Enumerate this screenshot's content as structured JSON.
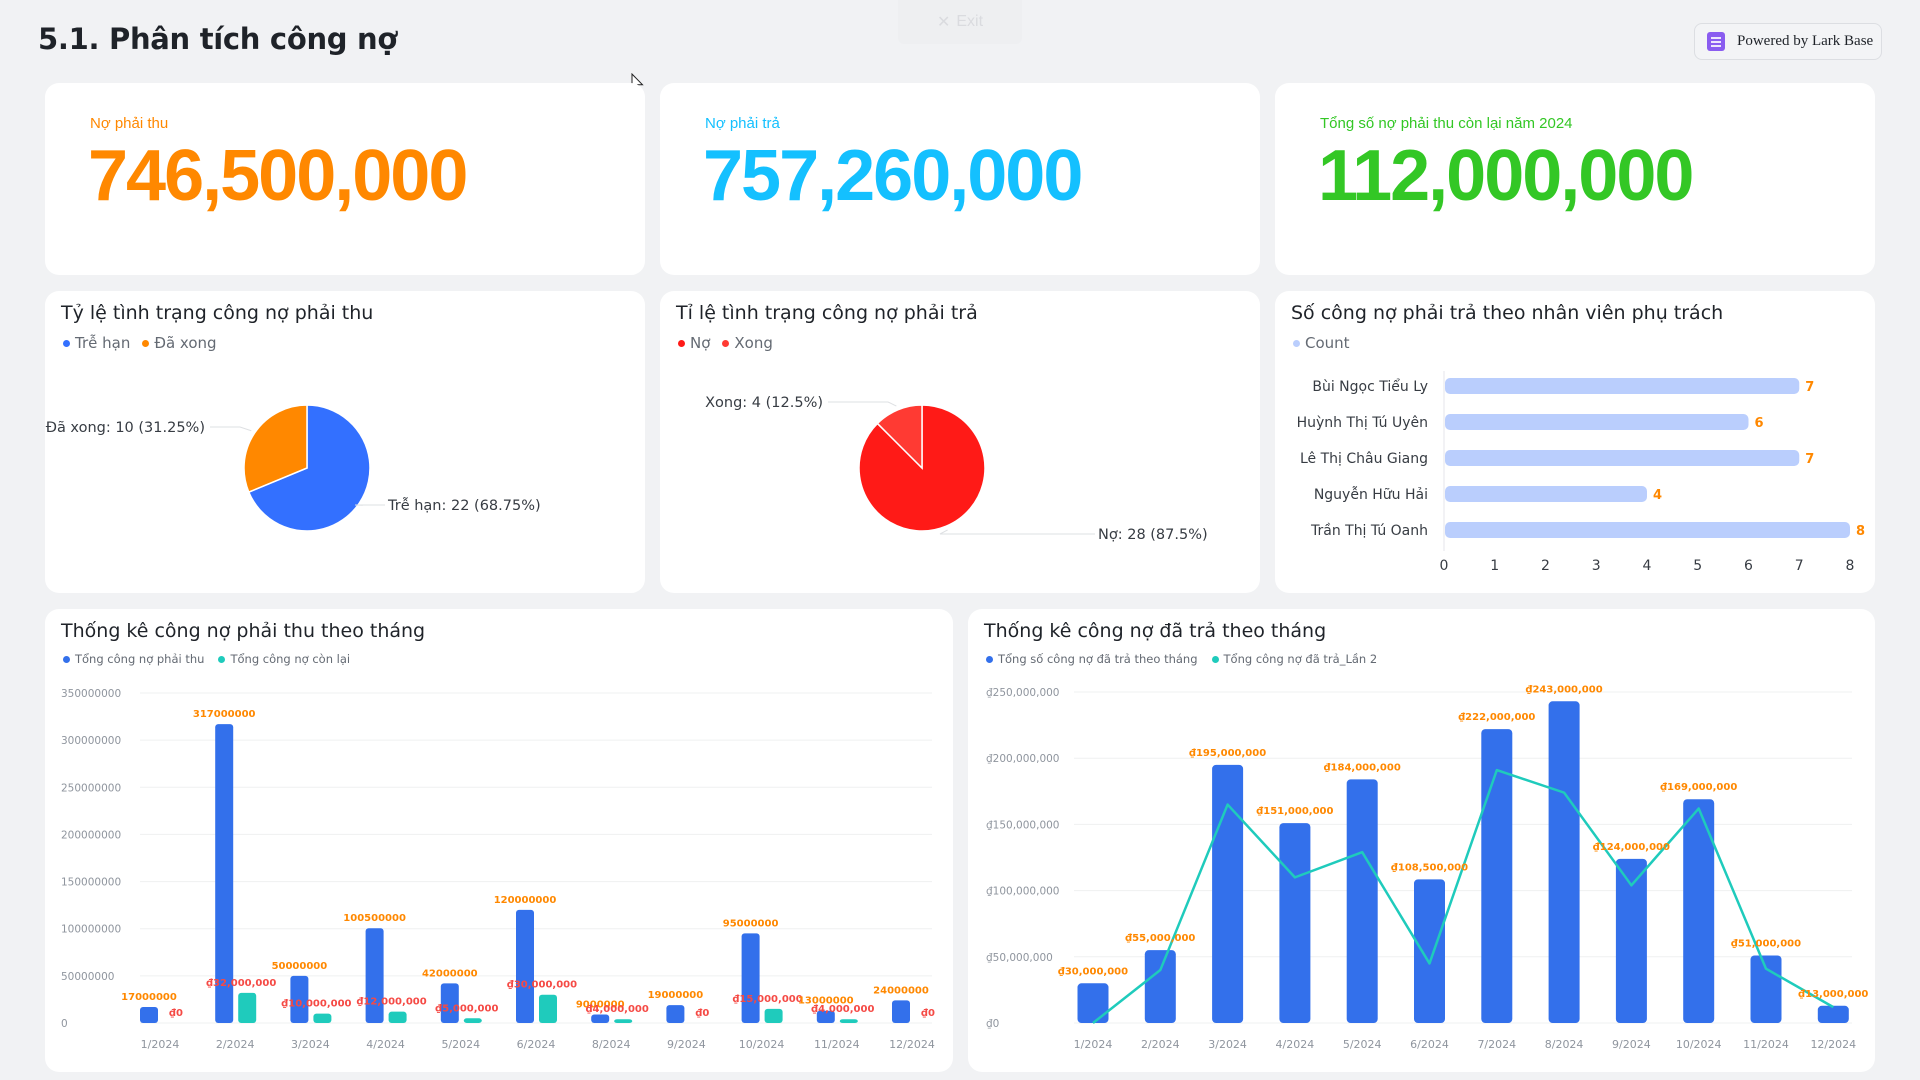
{
  "header": {
    "title": "5.1. Phân tích công nợ",
    "exit_label": "Exit",
    "exit_icon": "close-icon",
    "powered_by": "Powered by Lark Base",
    "powered_icon": "lark-base-logo-icon"
  },
  "colors": {
    "orange": "#ff8800",
    "cyan": "#14c0ff",
    "green": "#33c725",
    "blue": "#3370eb",
    "teal": "#1fcbbc",
    "red": "#f54a45",
    "pie_red_main": "#ff1a17",
    "pie_red_small": "#ff3a33",
    "hbar": "#bacefd"
  },
  "kpis": [
    {
      "label": "Nợ phải thu",
      "value": "746,500,000",
      "color": "#ff8800"
    },
    {
      "label": "Nợ phải trả",
      "value": "757,260,000",
      "color": "#14c0ff"
    },
    {
      "label": "Tổng số nợ phải thu còn lại năm 2024",
      "value": "112,000,000",
      "color": "#33c725"
    }
  ],
  "chart_data": [
    {
      "type": "pie",
      "title": "Tỷ lệ tình trạng công nợ phải thu",
      "legend": [
        "Trễ hạn",
        "Đã xong"
      ],
      "legend_position": "top-left",
      "slices": [
        {
          "name": "Trễ hạn",
          "value": 22,
          "percent": 68.75,
          "color": "#3370ff",
          "label": "Trễ hạn: 22 (68.75%)"
        },
        {
          "name": "Đã xong",
          "value": 10,
          "percent": 31.25,
          "color": "#ff8800",
          "label": "Đã xong: 10 (31.25%)"
        }
      ]
    },
    {
      "type": "pie",
      "title": "Tỉ lệ tình trạng công nợ phải trả",
      "legend": [
        "Nợ",
        "Xong"
      ],
      "legend_position": "top-left",
      "slices": [
        {
          "name": "Nợ",
          "value": 28,
          "percent": 87.5,
          "color": "#ff1a17",
          "label": "Nợ: 28 (87.5%)"
        },
        {
          "name": "Xong",
          "value": 4,
          "percent": 12.5,
          "color": "#ff3a33",
          "label": "Xong: 4 (12.5%)"
        }
      ]
    },
    {
      "type": "bar",
      "orientation": "horizontal",
      "title": "Số công nợ phải trả theo nhân viên phụ trách",
      "legend": [
        "Count"
      ],
      "legend_position": "top-left",
      "categories": [
        "Bùi Ngọc Tiểu Ly",
        "Huỳnh Thị Tú Uyên",
        "Lê Thị Châu Giang",
        "Nguyễn Hữu Hải",
        "Trần Thị Tú Oanh"
      ],
      "values": [
        7,
        6,
        7,
        4,
        8
      ],
      "xlim": [
        0,
        8
      ],
      "xticks": [
        "0",
        "1",
        "2",
        "3",
        "4",
        "5",
        "6",
        "7",
        "8"
      ]
    },
    {
      "type": "bar",
      "title": "Thống kê công nợ phải thu theo tháng",
      "legend_position": "top-left",
      "categories": [
        "1/2024",
        "2/2024",
        "3/2024",
        "4/2024",
        "5/2024",
        "6/2024",
        "8/2024",
        "9/2024",
        "10/2024",
        "11/2024",
        "12/2024"
      ],
      "series": [
        {
          "name": "Tổng công nợ phải thu",
          "color": "#3370eb",
          "values": [
            17000000,
            317000000,
            50000000,
            100500000,
            42000000,
            120000000,
            9000000,
            19000000,
            95000000,
            13000000,
            24000000
          ],
          "labels": [
            "17000000",
            "317000000",
            "50000000",
            "100500000",
            "42000000",
            "120000000",
            "9000000",
            "19000000",
            "95000000",
            "13000000",
            "24000000"
          ]
        },
        {
          "name": "Tổng công nợ còn lại",
          "color": "#1fcbbc",
          "values": [
            0,
            32000000,
            10000000,
            12000000,
            5000000,
            30000000,
            4000000,
            0,
            15000000,
            4000000,
            0
          ],
          "labels": [
            "₫0",
            "₫32,000,000",
            "₫10,000,000",
            "₫12,000,000",
            "₫5,000,000",
            "₫30,000,000",
            "₫4,000,000",
            "₫0",
            "₫15,000,000",
            "₫4,000,000",
            "₫0"
          ]
        }
      ],
      "ylim": [
        0,
        350000000
      ],
      "yticks": [
        "0",
        "50000000",
        "100000000",
        "150000000",
        "200000000",
        "250000000",
        "300000000",
        "350000000"
      ],
      "grid": true
    },
    {
      "type": "bar",
      "title": "Thống kê công nợ đã trả theo tháng",
      "legend_position": "top-left",
      "categories": [
        "1/2024",
        "2/2024",
        "3/2024",
        "4/2024",
        "5/2024",
        "6/2024",
        "7/2024",
        "8/2024",
        "9/2024",
        "10/2024",
        "11/2024",
        "12/2024"
      ],
      "series": [
        {
          "name": "Tổng số công nợ đã trả theo tháng",
          "type": "bar",
          "color": "#3370eb",
          "values": [
            30000000,
            55000000,
            195000000,
            151000000,
            184000000,
            108500000,
            222000000,
            243000000,
            124000000,
            169000000,
            51000000,
            13000000
          ],
          "labels": [
            "₫30,000,000",
            "₫55,000,000",
            "₫195,000,000",
            "₫151,000,000",
            "₫184,000,000",
            "₫108,500,000",
            "₫222,000,000",
            "₫243,000,000",
            "₫124,000,000",
            "₫169,000,000",
            "₫51,000,000",
            "₫13,000,000"
          ]
        },
        {
          "name": "Tổng công nợ đã trả_Lần 2",
          "type": "line",
          "color": "#1fcbbc",
          "values": [
            0,
            40000000,
            165000000,
            110000000,
            129000000,
            45000000,
            191000000,
            174000000,
            104000000,
            162000000,
            41000000,
            12000000
          ]
        }
      ],
      "ylim": [
        0,
        250000000
      ],
      "yticks": [
        "₫0",
        "₫50,000,000",
        "₫100,000,000",
        "₫150,000,000",
        "₫200,000,000",
        "₫250,000,000"
      ],
      "grid": true
    }
  ]
}
